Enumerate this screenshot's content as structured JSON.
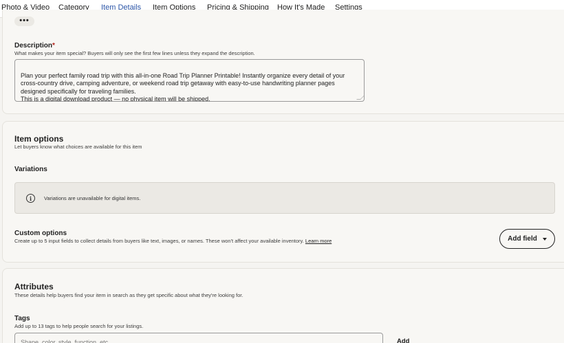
{
  "tabs": [
    {
      "label": "Photo & Video"
    },
    {
      "label": "Category"
    },
    {
      "label": "Item Details"
    },
    {
      "label": "Item Options"
    },
    {
      "label": "Pricing & Shipping"
    },
    {
      "label": "How It's Made"
    },
    {
      "label": "Settings"
    }
  ],
  "active_tab": "Item Details",
  "description": {
    "label": "Description",
    "required_mark": "*",
    "hint": "What makes your item special? Buyers will only see the first few lines unless they expand the description.",
    "value": "Plan your perfect family road trip with this all-in-one Road Trip Planner Printable! Instantly organize every detail of your cross-country drive, camping adventure, or weekend road trip getaway with easy-to-use handwriting planner pages designed specifically for traveling families.\nThis is a digital download product — no physical item will be shipped."
  },
  "item_options": {
    "title": "Item options",
    "hint": "Let buyers know what choices are available for this item",
    "variations_label": "Variations",
    "variations_notice": "Variations are unavailable for digital items.",
    "custom_options_label": "Custom options",
    "custom_options_hint": "Create up to 5 input fields to collect details from buyers like text, images, or names. These won't affect your available inventory.",
    "learn_more": "Learn more",
    "add_field_label": "Add field"
  },
  "attributes": {
    "title": "Attributes",
    "hint": "These details help buyers find your item in search as they get specific about what they're looking for.",
    "tags_label": "Tags",
    "tags_hint": "Add up to 13 tags to help people search for your listings.",
    "tags_placeholder": "Shape, color, style, function, etc.",
    "add_label": "Add"
  },
  "colors": {
    "accent": "#2c56a8",
    "required": "#b3261e"
  },
  "icons": {
    "more": "more-dots-icon",
    "info": "info-icon",
    "dropdown": "caret-down-icon"
  }
}
